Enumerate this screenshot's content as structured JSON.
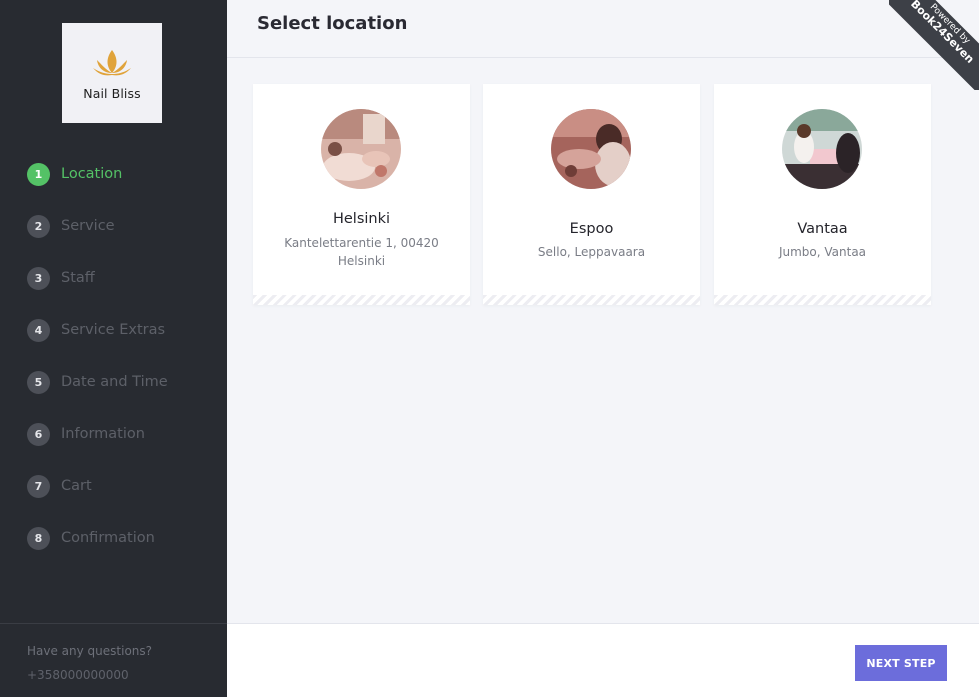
{
  "brand": {
    "name": "Nail Bliss",
    "accent_color": "#e0a33a"
  },
  "header": {
    "title": "Select location"
  },
  "ribbon": {
    "line1": "Powered by",
    "line2": "Book24Seven"
  },
  "steps": [
    {
      "num": "1",
      "label": "Location",
      "active": true
    },
    {
      "num": "2",
      "label": "Service"
    },
    {
      "num": "3",
      "label": "Staff"
    },
    {
      "num": "4",
      "label": "Service Extras"
    },
    {
      "num": "5",
      "label": "Date and Time"
    },
    {
      "num": "6",
      "label": "Information"
    },
    {
      "num": "7",
      "label": "Cart"
    },
    {
      "num": "8",
      "label": "Confirmation"
    }
  ],
  "sidebar_footer": {
    "question": "Have any questions?",
    "phone": "+358000000000"
  },
  "locations": [
    {
      "name": "Helsinki",
      "address": "Kantelettarentie 1, 00420 Helsinki"
    },
    {
      "name": "Espoo",
      "address": "Sello, Leppavaara"
    },
    {
      "name": "Vantaa",
      "address": "Jumbo, Vantaa"
    }
  ],
  "footer": {
    "next_label": "NEXT STEP"
  },
  "colors": {
    "active_step": "#54c266",
    "button": "#6c6ddb",
    "sidebar": "#282b31"
  }
}
